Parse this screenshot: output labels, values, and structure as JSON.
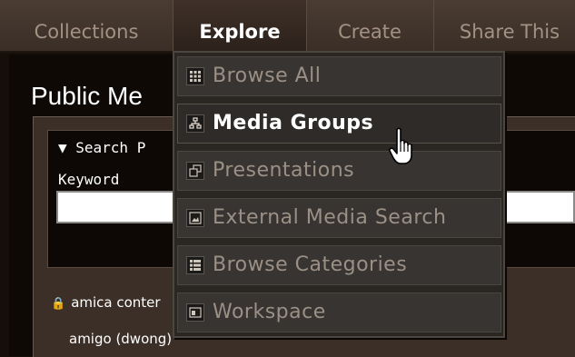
{
  "nav": {
    "items": [
      {
        "label": "Collections"
      },
      {
        "label": "Explore"
      },
      {
        "label": "Create"
      },
      {
        "label": "Share This"
      }
    ]
  },
  "page": {
    "title": "Public Me",
    "search_toggle": "▼ Search P",
    "keyword_label": "Keyword",
    "owner": "amica conter",
    "user": "amigo  (dwong)"
  },
  "dropdown": {
    "items": [
      {
        "label": "Browse All",
        "icon": "grid-icon"
      },
      {
        "label": "Media Groups",
        "icon": "hierarchy-icon",
        "hovered": true
      },
      {
        "label": "Presentations",
        "icon": "stacked-windows-icon"
      },
      {
        "label": "External Media Search",
        "icon": "picture-icon"
      },
      {
        "label": "Browse Categories",
        "icon": "list-icon"
      },
      {
        "label": "Workspace",
        "icon": "window-icon"
      }
    ]
  },
  "colors": {
    "nav_bg": "#4a3c33",
    "menu_bg": "#383431",
    "panel_bg": "#3c2f28",
    "active_text": "#ffffff",
    "inactive_text": "#9a9086"
  }
}
